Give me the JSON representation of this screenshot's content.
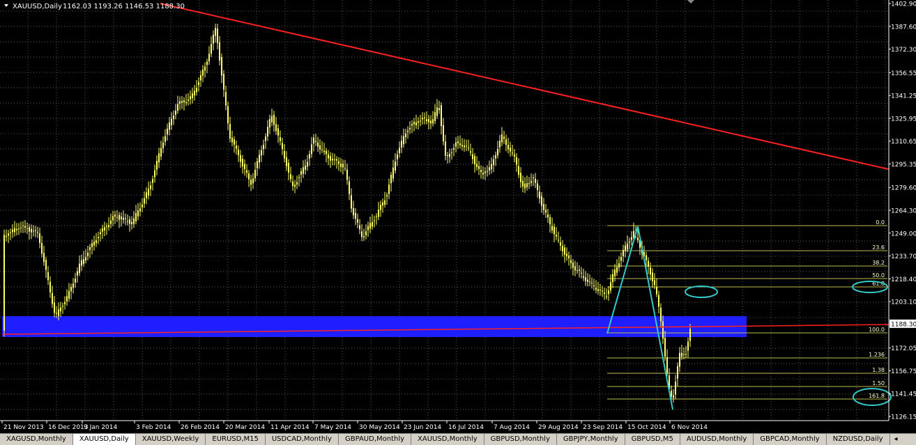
{
  "header": {
    "symbol": "XAUUSD,Daily",
    "ohlc": "1162.03 1193.26 1146.53 1188.30"
  },
  "price_scale": {
    "labels": [
      "1402.90",
      "1387.60",
      "1372.30",
      "1356.55",
      "1341.25",
      "1325.95",
      "1310.65",
      "1295.35",
      "1279.60",
      "1264.30",
      "1249.00",
      "1233.70",
      "1218.40",
      "1203.10",
      "1188.30",
      "1172.05",
      "1156.75",
      "1141.45",
      "1126.15"
    ],
    "current": "1188.30"
  },
  "time_scale": {
    "labels": [
      "21 Nov 2013",
      "16 Dec 2013",
      "9 Jan 2014",
      "3 Feb 2014",
      "26 Feb 2014",
      "20 Mar 2014",
      "11 Apr 2014",
      "7 May 2014",
      "30 May 2014",
      "23 Jun 2014",
      "16 Jul 2014",
      "7 Aug 2014",
      "29 Aug 2014",
      "23 Sep 2014",
      "15 Oct 2014",
      "6 Nov 2014"
    ]
  },
  "fibonacci": {
    "levels": [
      "0.0",
      "23.6",
      "38.2",
      "50.0",
      "61.8",
      "100.0",
      "1.236",
      "1.38",
      "1.50",
      "161.8"
    ],
    "highlighted": [
      "61.8",
      "161.8"
    ]
  },
  "colors": {
    "background": "#000000",
    "candles": "#ffff66",
    "trendline": "#ff2020",
    "support_zone": "#1e1eff",
    "fib_lines": "#bdbd50",
    "pattern": "#33cccc",
    "grid": "#5a5a5a",
    "axis_text": "#ffffff"
  },
  "tabs": {
    "items": [
      "XAGUSD,Monthly",
      "XAUUSD,Daily",
      "XAUUSD,Weekly",
      "EURUSD,M15",
      "USDCAD,Monthly",
      "GBPAUD,Monthly",
      "XAUUSD,Monthly",
      "GBPUSD,Monthly",
      "GBPJPY,Monthly",
      "GBPUSD,M5",
      "AUDUSD,Monthly",
      "GBPCAD,Monthly",
      "NZDUSD,Daily"
    ],
    "active_index": 1,
    "scroll_label": "◂"
  }
}
